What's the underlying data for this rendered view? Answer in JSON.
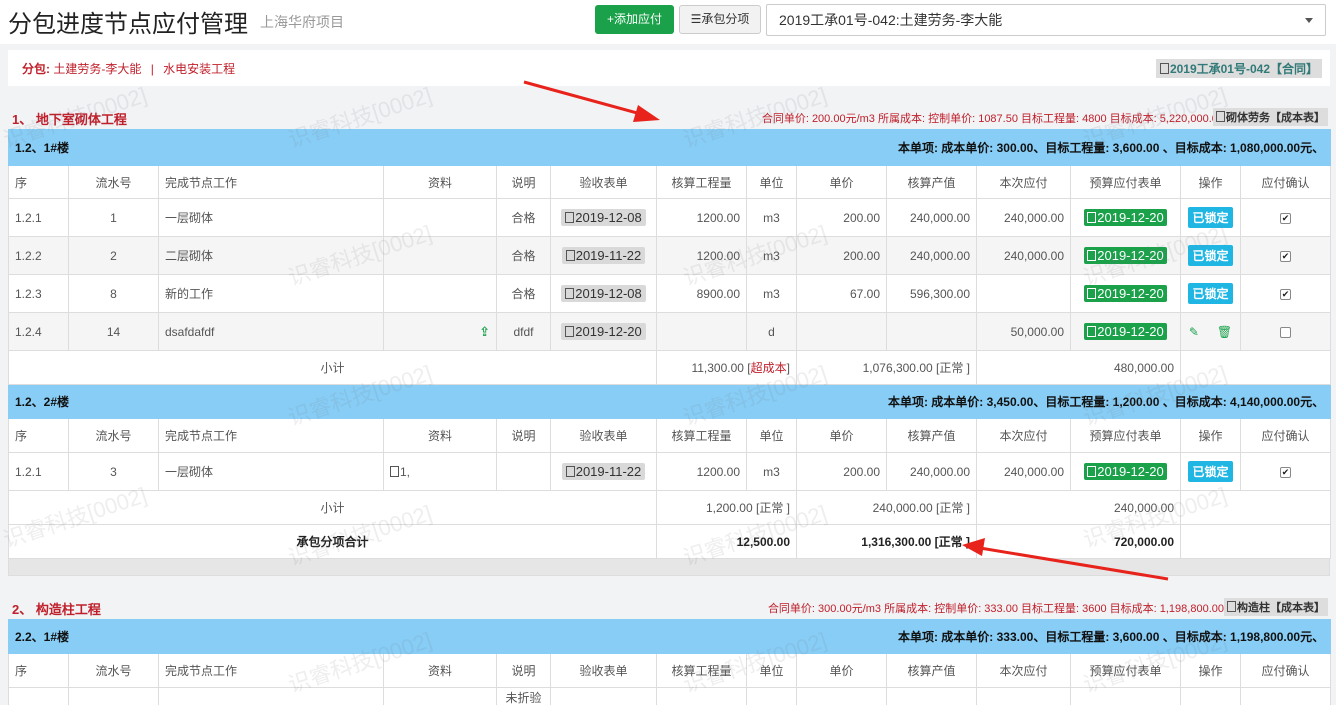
{
  "header": {
    "title": "分包进度节点应付管理",
    "subtitle": "上海华府项目",
    "add_button": "+添加应付",
    "sub_button": "☰承包分项",
    "select_value": "2019工承01号-042:土建劳务-李大能"
  },
  "info": {
    "label": "分包:",
    "contractor": "土建劳务-李大能",
    "sep": "|",
    "trade": "水电安装工程",
    "contract_tag": "2019工承01号-042【合同】"
  },
  "columns": [
    "序",
    "流水号",
    "完成节点工作",
    "资料",
    "说明",
    "验收表单",
    "核算工程量",
    "单位",
    "单价",
    "核算产值",
    "本次应付",
    "预算应付表单",
    "操作",
    "应付确认"
  ],
  "sections": [
    {
      "title": "1、 地下室砌体工程",
      "meta": "合同单价: 200.00元/m3 所属成本:  控制单价: 1087.50 目标工程量: 4800 目标成本: 5,220,000.00",
      "cost_btn": "砌体劳务【成本表】",
      "groups": [
        {
          "name": "1.2、1#楼",
          "summary": "本单项: 成本单价: 300.00、目标工程量: 3,600.00 、目标成本: 1,080,000.00元、",
          "rows": [
            {
              "seq": "1.2.1",
              "no": "1",
              "work": "一层砌体",
              "doc": "",
              "note": "合格",
              "form": "2019-12-08",
              "qty": "1200.00",
              "unit": "m3",
              "price": "200.00",
              "value": "240,000.00",
              "pay": "240,000.00",
              "budget": "2019-12-20",
              "op": "已锁定",
              "checked": true
            },
            {
              "seq": "1.2.2",
              "no": "2",
              "work": "二层砌体",
              "doc": "",
              "note": "合格",
              "form": "2019-11-22",
              "qty": "1200.00",
              "unit": "m3",
              "price": "200.00",
              "value": "240,000.00",
              "pay": "240,000.00",
              "budget": "2019-12-20",
              "op": "已锁定",
              "checked": true
            },
            {
              "seq": "1.2.3",
              "no": "8",
              "work": "新的工作",
              "doc": "",
              "note": "合格",
              "form": "2019-12-08",
              "qty": "8900.00",
              "unit": "m3",
              "price": "67.00",
              "value": "596,300.00",
              "pay": "",
              "budget": "2019-12-20",
              "op": "已锁定",
              "checked": true
            },
            {
              "seq": "1.2.4",
              "no": "14",
              "work": "dsafdafdf",
              "doc": "upload",
              "note": "dfdf",
              "form": "2019-12-20",
              "qty": "",
              "unit": "d",
              "price": "",
              "value": "",
              "pay": "50,000.00",
              "budget": "2019-12-20",
              "op": "edit",
              "checked": false
            }
          ],
          "subtotal_label": "小计",
          "subtotal_qty": "11,300.00 [",
          "subtotal_qty_flag": "超成本",
          "subtotal_value": "1,076,300.00 [正常 ]",
          "subtotal_pay": "480,000.00"
        },
        {
          "name": "1.2、2#楼",
          "summary": "本单项: 成本单价: 3,450.00、目标工程量: 1,200.00 、目标成本: 4,140,000.00元、",
          "rows": [
            {
              "seq": "1.2.1",
              "no": "3",
              "work": "一层砌体",
              "doc": "1,",
              "note": "",
              "form": "2019-11-22",
              "qty": "1200.00",
              "unit": "m3",
              "price": "200.00",
              "value": "240,000.00",
              "pay": "240,000.00",
              "budget": "2019-12-20",
              "op": "已锁定",
              "checked": true
            }
          ],
          "subtotal_label": "小计",
          "subtotal_qty": "1,200.00 [正常 ]",
          "subtotal_value": "240,000.00 [正常 ]",
          "subtotal_pay": "240,000.00"
        }
      ],
      "total_label": "承包分项合计",
      "total_qty": "12,500.00",
      "total_value": "1,316,300.00 [正常 ]",
      "total_pay": "720,000.00"
    },
    {
      "title": "2、 构造柱工程",
      "meta": "合同单价: 300.00元/m3 所属成本:  控制单价: 333.00 目标工程量: 3600 目标成本: 1,198,800.00",
      "cost_btn": "构造柱【成本表】",
      "groups": [
        {
          "name": "2.2、1#楼",
          "summary": "本单项: 成本单价: 333.00、目标工程量: 3,600.00 、目标成本: 1,198,800.00元、",
          "partial_note": "未折验"
        }
      ]
    }
  ],
  "watermark": "识睿科技[0002]",
  "colors": {
    "accent_red": "#c0202b",
    "green": "#1aa14a",
    "lock_blue": "#1fb6e3",
    "group_blue": "#87cdf5",
    "arrow_red": "#e8231b"
  }
}
